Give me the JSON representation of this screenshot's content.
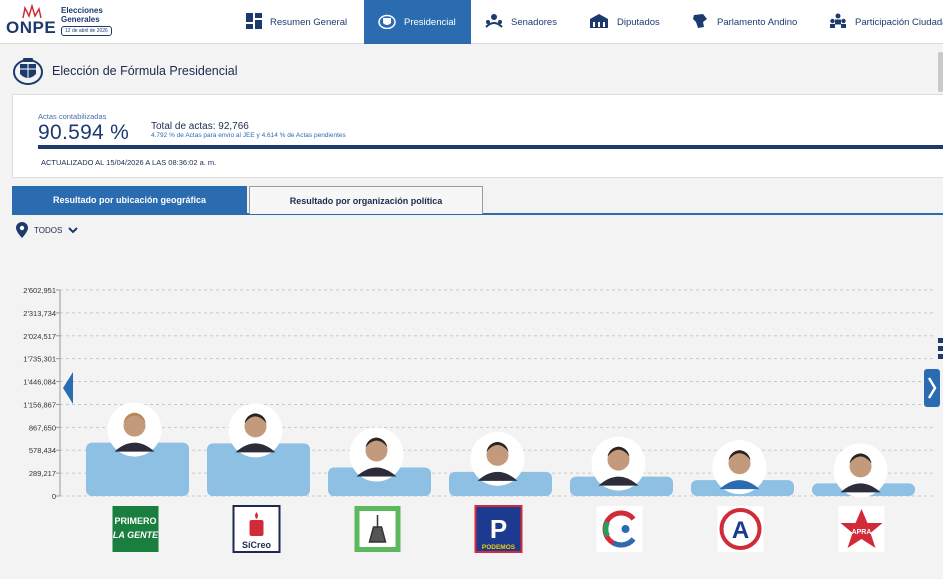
{
  "header": {
    "logo_text": "ONPE",
    "logo_subtitle": "Elecciones Generales",
    "logo_date": "12 de abril de 2026",
    "nav": [
      {
        "label": "Resumen General",
        "icon": "dashboard-icon",
        "active": false
      },
      {
        "label": "Presidencial",
        "icon": "presidential-seal-icon",
        "active": true
      },
      {
        "label": "Senadores",
        "icon": "senate-icon",
        "active": false
      },
      {
        "label": "Diputados",
        "icon": "congress-building-icon",
        "active": false
      },
      {
        "label": "Parlamento Andino",
        "icon": "andean-map-icon",
        "active": false
      },
      {
        "label": "Participación Ciudadana",
        "icon": "people-icon",
        "active": false
      }
    ]
  },
  "page": {
    "title": "Elección de Fórmula Presidencial"
  },
  "summary": {
    "actas_label": "Actas contabilizadas",
    "actas_percent": "90.594 %",
    "actas_fraction": 0.90594,
    "total_label": "Total de actas: 92,766",
    "detail": "4.792 % de Actas para envío al JEE y 4.614 % de Actas pendientes",
    "updated": "ACTUALIZADO AL 15/04/2026 A LAS 08:36:02 a. m."
  },
  "tabs": [
    {
      "label": "Resultado por ubicación geográfica",
      "active": true
    },
    {
      "label": "Resultado por organización política",
      "active": false
    }
  ],
  "filter": {
    "label": "TODOS"
  },
  "colors": {
    "primary": "#2b6cb0",
    "navy": "#1c3a6e",
    "bar": "#8ec0e4"
  },
  "chart_data": {
    "type": "bar",
    "yticks": [
      "2'602,951",
      "2'313,734",
      "2'024,517",
      "1'735,301",
      "1'446,084",
      "1'156,867",
      "867,650",
      "578,434",
      "289,217",
      "0"
    ],
    "ylim": [
      0,
      2602951
    ],
    "grid": true,
    "categories": [
      "PRIMERO LA GENTE",
      "SíCreo",
      "Partido con escoba",
      "PODEMOS",
      "Partido C",
      "Partido A",
      "APRA"
    ],
    "values": [
      675000,
      665000,
      360000,
      305000,
      245000,
      200000,
      160000
    ],
    "party_logos": [
      {
        "line1": "PRIMERO",
        "line2": "LA GENTE",
        "icon": "primero-la-gente-logo"
      },
      {
        "text": "SíCreo",
        "icon": "sicreo-logo"
      },
      {
        "icon": "broom-party-logo"
      },
      {
        "text": "PODEMOS",
        "letter": "P",
        "icon": "podemos-logo"
      },
      {
        "letter": "C",
        "icon": "c-party-logo"
      },
      {
        "letter": "A",
        "icon": "a-party-logo"
      },
      {
        "text": "APRA",
        "icon": "apra-star-logo"
      }
    ]
  }
}
